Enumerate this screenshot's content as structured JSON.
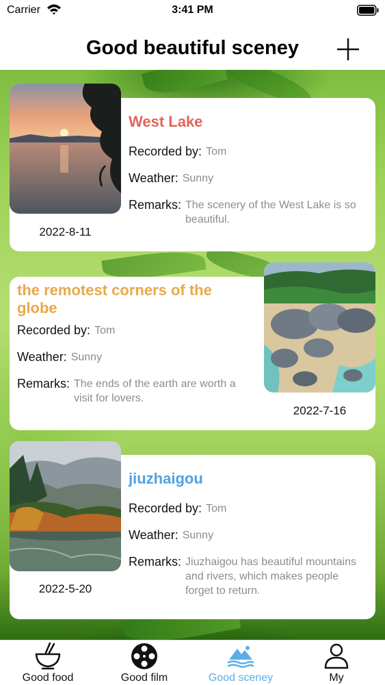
{
  "status_bar": {
    "carrier": "Carrier",
    "time": "3:41 PM"
  },
  "nav": {
    "title": "Good beautiful sceney",
    "add_icon": "plus-icon"
  },
  "labels": {
    "recorded_by": "Recorded by:",
    "weather": "Weather:",
    "remarks": "Remarks:"
  },
  "entries": [
    {
      "title": "West Lake",
      "title_color": "#e0645c",
      "recorded_by": "Tom",
      "weather": "Sunny",
      "remarks": "The scenery of the West Lake is so beautiful.",
      "date": "2022-8-11"
    },
    {
      "title": "the remotest corners of the globe",
      "title_color": "#e8a94a",
      "recorded_by": "Tom",
      "weather": "Sunny",
      "remarks": "The ends of the earth are worth a visit for lovers.",
      "date": "2022-7-16"
    },
    {
      "title": "jiuzhaigou",
      "title_color": "#4fa1e0",
      "recorded_by": "Tom",
      "weather": "Sunny",
      "remarks": "Jiuzhaigou has beautiful mountains and rivers, which makes people forget to return.",
      "date": "2022-5-20"
    }
  ],
  "tabs": [
    {
      "label": "Good food",
      "icon": "bowl-chopsticks-icon",
      "active": false
    },
    {
      "label": "Good film",
      "icon": "film-reel-icon",
      "active": false
    },
    {
      "label": "Good sceney",
      "icon": "mountain-landscape-icon",
      "active": true
    },
    {
      "label": "My",
      "icon": "person-icon",
      "active": false
    }
  ],
  "colors": {
    "active_tab": "#5aaee6",
    "background_green": "#9fd25a"
  }
}
